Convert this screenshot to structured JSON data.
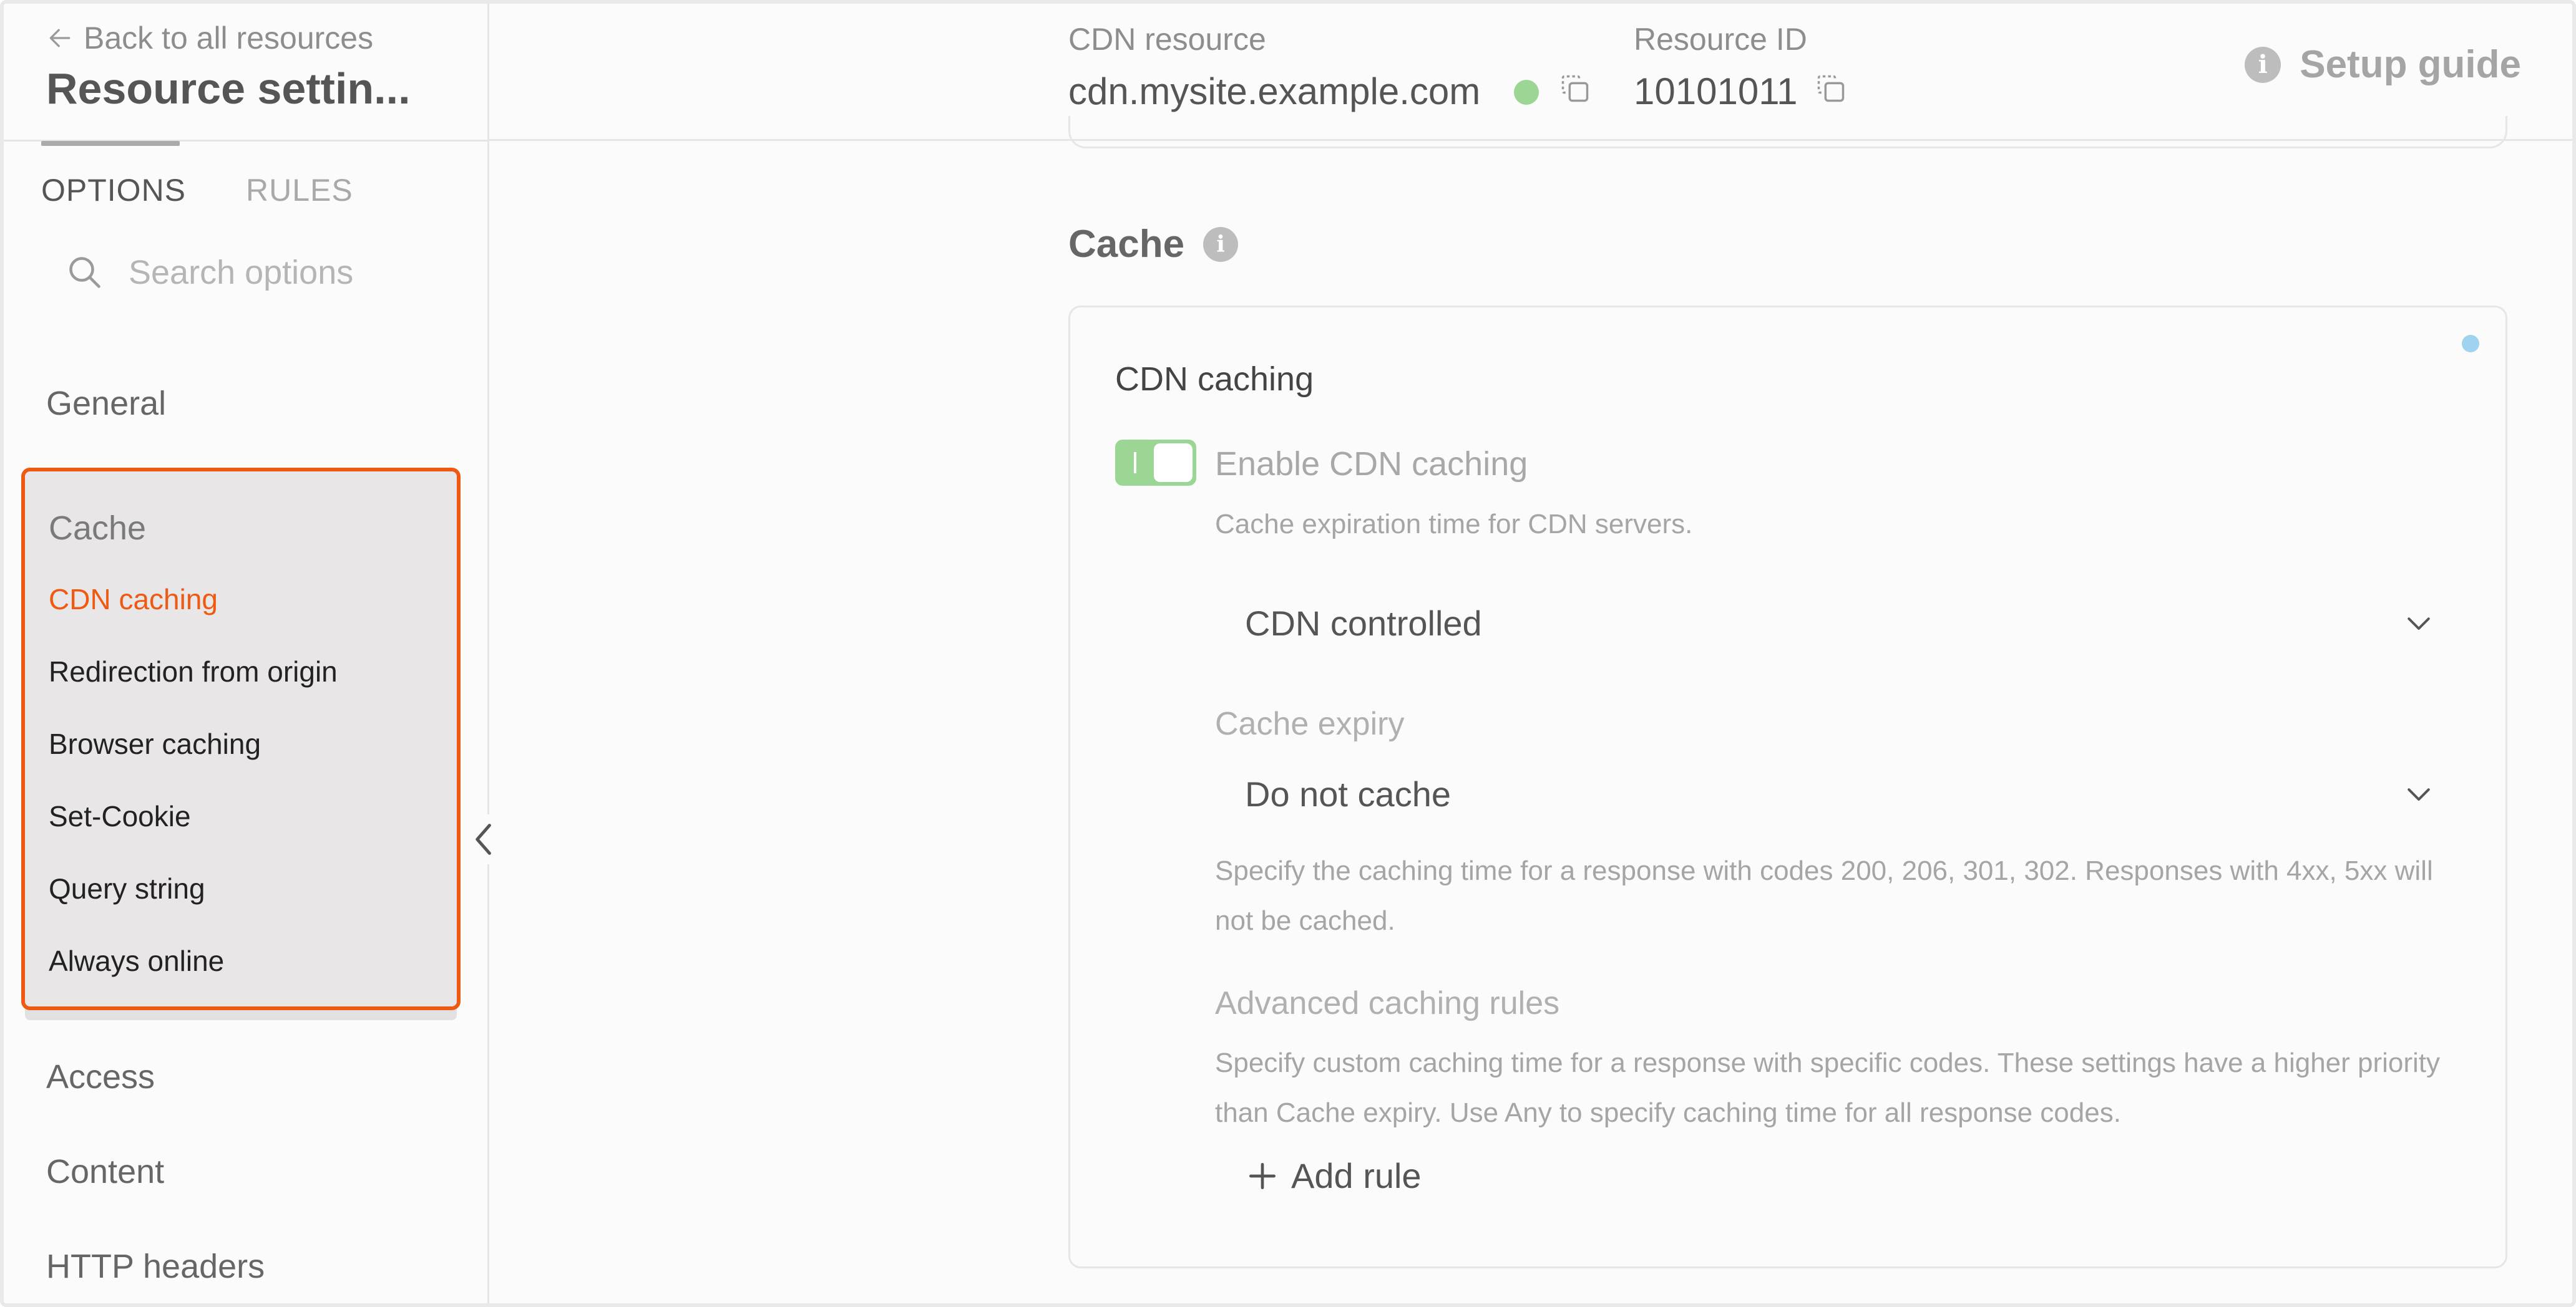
{
  "sidebar": {
    "back_label": "Back to all resources",
    "title": "Resource settin...",
    "tabs": [
      {
        "label": "OPTIONS",
        "active": true
      },
      {
        "label": "RULES",
        "active": false
      }
    ],
    "search_placeholder": "Search options",
    "groups": {
      "general": "General",
      "cache": {
        "label": "Cache",
        "items": [
          "CDN caching",
          "Redirection from origin",
          "Browser caching",
          "Set-Cookie",
          "Query string",
          "Always online"
        ],
        "active_item": "CDN caching"
      },
      "access": "Access",
      "content": "Content",
      "http_headers": "HTTP headers"
    }
  },
  "header": {
    "cdn_resource_label": "CDN resource",
    "cdn_resource_value": "cdn.mysite.example.com",
    "resource_id_label": "Resource ID",
    "resource_id_value": "10101011",
    "setup_guide_label": "Setup guide"
  },
  "main": {
    "section_title": "Cache",
    "card": {
      "title": "CDN caching",
      "toggle_label": "Enable CDN caching",
      "toggle_on": true,
      "toggle_hint": "Cache expiration time for CDN servers.",
      "mode_select": "CDN controlled",
      "expiry_label": "Cache expiry",
      "expiry_select": "Do not cache",
      "expiry_hint": "Specify the caching time for a response with codes 200, 206, 301, 302. Responses with 4xx, 5xx will not be cached.",
      "advanced_label": "Advanced caching rules",
      "advanced_hint": "Specify custom caching time for a response with specific codes. These settings have a higher priority than Cache expiry. Use Any to specify caching time for all response codes.",
      "add_rule_label": "Add rule"
    }
  },
  "colors": {
    "accent": "#ee5a12",
    "status_ok": "#9cd695",
    "toggle_on": "#9cd695"
  }
}
